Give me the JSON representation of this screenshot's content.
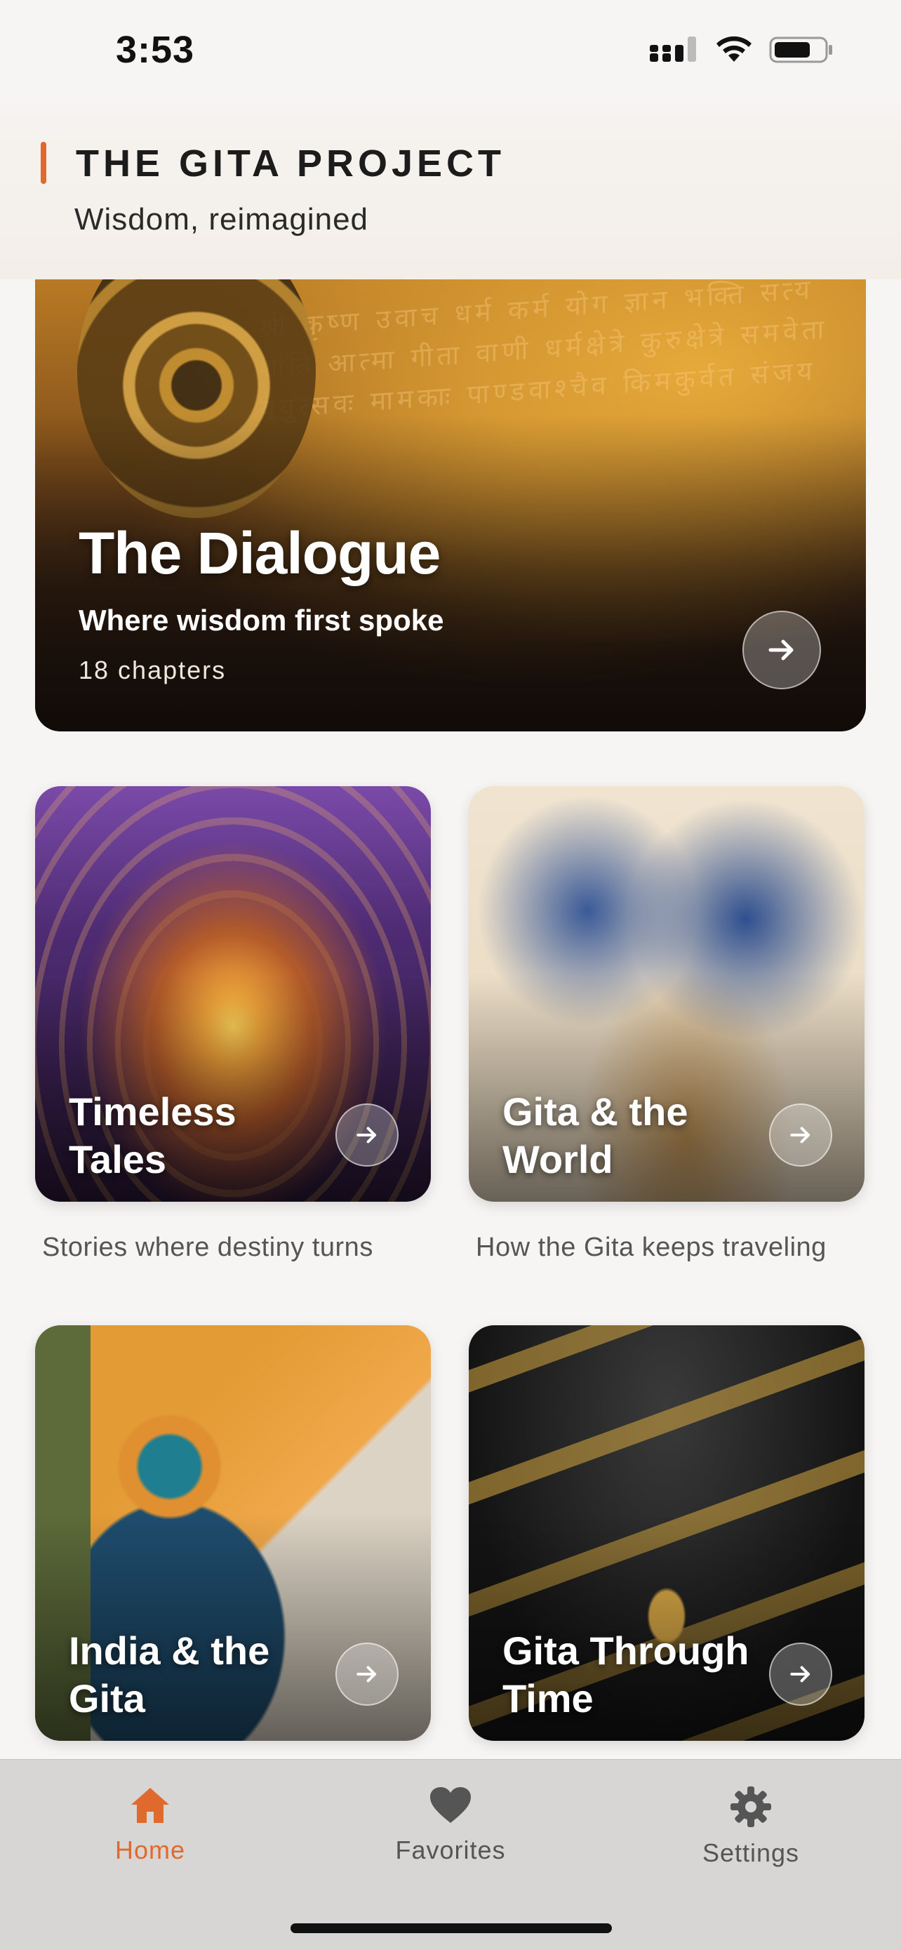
{
  "status_bar": {
    "time": "3:53"
  },
  "header": {
    "title": "THE GITA PROJECT",
    "subtitle": "Wisdom, reimagined",
    "accent_color": "#e06a2e"
  },
  "hero": {
    "title": "The Dialogue",
    "tagline": "Where wisdom first spoke",
    "meta": "18 chapters"
  },
  "cards": [
    {
      "title": "Timeless Tales",
      "caption": "Stories where destiny turns"
    },
    {
      "title": "Gita & the World",
      "caption": "How the Gita keeps traveling"
    },
    {
      "title": "India & the Gita",
      "caption": ""
    },
    {
      "title": "Gita Through Time",
      "caption": ""
    }
  ],
  "tabbar": {
    "items": [
      {
        "label": "Home",
        "icon": "home-icon",
        "active": true
      },
      {
        "label": "Favorites",
        "icon": "heart-icon",
        "active": false
      },
      {
        "label": "Settings",
        "icon": "gear-icon",
        "active": false
      }
    ],
    "active_color": "#e06a2e"
  }
}
